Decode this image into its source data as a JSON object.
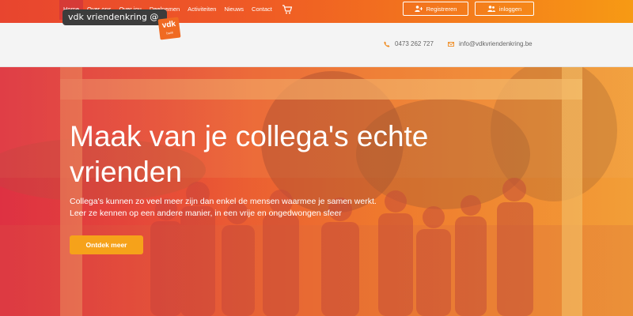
{
  "nav": {
    "items": [
      {
        "label": "Home",
        "active": true
      },
      {
        "label": "Over ons"
      },
      {
        "label": "Over jou"
      },
      {
        "label": "Deelnemen"
      },
      {
        "label": "Activiteiten"
      },
      {
        "label": "Nieuws"
      },
      {
        "label": "Contact"
      }
    ],
    "cart_icon": "cart-icon"
  },
  "auth": {
    "register_label": "Registreren",
    "login_label": "inloggen"
  },
  "header": {
    "logo_text": "vdk vriendenkring @",
    "badge_main": "vdk",
    "badge_sub": "bank",
    "phone": "0473 262 727",
    "email": "info@vdkvriendenkring.be"
  },
  "hero": {
    "title": "Maak van je collega's echte vrienden",
    "text_line1": "Collega's kunnen zo veel meer zijn dan enkel de mensen waarmee je samen werkt.",
    "text_line2": "Leer ze kennen op een andere manier, in een vrije en ongedwongen sfeer",
    "cta_label": "Ontdek meer"
  },
  "colors": {
    "topbar_start": "#e8452f",
    "topbar_end": "#f79a14",
    "nav_active": "#d63a37",
    "accent_orange": "#f6a21a",
    "logo_dark": "#3c3c3c"
  }
}
